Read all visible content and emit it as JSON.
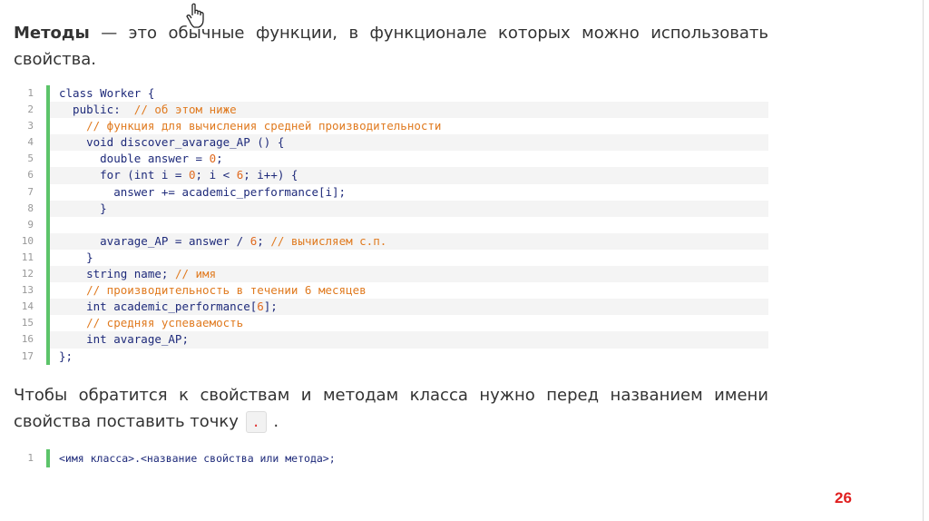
{
  "intro": {
    "term": "Методы",
    "rest_line1": " — это обычные функции, в функционале которых можно использовать",
    "rest_line2": "свойства."
  },
  "code_block": {
    "lines": [
      {
        "n": "1",
        "text": "class Worker {"
      },
      {
        "n": "2",
        "text": "  public:  // об этом ниже"
      },
      {
        "n": "3",
        "text": "    // функция для вычисления средней производительности"
      },
      {
        "n": "4",
        "text": "    void discover_avarage_AP () {"
      },
      {
        "n": "5",
        "text": "      double answer = 0;"
      },
      {
        "n": "6",
        "text": "      for (int i = 0; i < 6; i++) {"
      },
      {
        "n": "7",
        "text": "        answer += academic_performance[i];"
      },
      {
        "n": "8",
        "text": "      }"
      },
      {
        "n": "9",
        "text": ""
      },
      {
        "n": "10",
        "text": "      avarage_AP = answer / 6; // вычисляем с.п."
      },
      {
        "n": "11",
        "text": "    }"
      },
      {
        "n": "12",
        "text": "    string name; // имя"
      },
      {
        "n": "13",
        "text": "    // производительность в течении 6 месяцев"
      },
      {
        "n": "14",
        "text": "    int academic_performance[6];"
      },
      {
        "n": "15",
        "text": "    // средняя успеваемость"
      },
      {
        "n": "16",
        "text": "    int avarage_AP;"
      },
      {
        "n": "17",
        "text": "};"
      }
    ]
  },
  "para2": {
    "line1": "Чтобы обратится к свойствам и методам класса нужно перед названием имени",
    "line2_before": "свойства поставить точку ",
    "inline_code": ".",
    "line2_after": " ."
  },
  "code_block_2": {
    "line_number": "1",
    "text": "<имя класса>.<название свойства или метода>;"
  },
  "page_number": "26"
}
